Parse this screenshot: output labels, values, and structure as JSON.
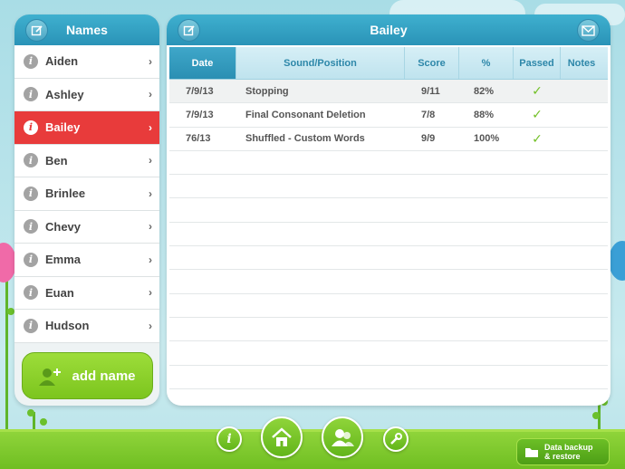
{
  "sidebar": {
    "title": "Names",
    "edit_icon": "pencil-edit-icon",
    "items": [
      {
        "label": "Aiden",
        "selected": false
      },
      {
        "label": "Ashley",
        "selected": false
      },
      {
        "label": "Bailey",
        "selected": true
      },
      {
        "label": "Ben",
        "selected": false
      },
      {
        "label": "Brinlee",
        "selected": false
      },
      {
        "label": "Chevy",
        "selected": false
      },
      {
        "label": "Emma",
        "selected": false
      },
      {
        "label": "Euan",
        "selected": false
      },
      {
        "label": "Hudson",
        "selected": false
      }
    ],
    "add_name_label": "add name"
  },
  "main": {
    "title": "Bailey",
    "table": {
      "columns": [
        "Date",
        "Sound/Position",
        "Score",
        "%",
        "Passed",
        "Notes"
      ],
      "active_column": "Date",
      "rows": [
        {
          "date": "7/9/13",
          "sound": "Stopping",
          "score": "9/11",
          "percent": "82%",
          "passed": true,
          "notes": ""
        },
        {
          "date": "7/9/13",
          "sound": "Final Consonant Deletion",
          "score": "7/8",
          "percent": "88%",
          "passed": true,
          "notes": ""
        },
        {
          "date": "76/13",
          "sound": "Shuffled - Custom Words",
          "score": "9/9",
          "percent": "100%",
          "passed": true,
          "notes": ""
        }
      ],
      "check_glyph": "✓"
    }
  },
  "bottom_nav": {
    "info_glyph": "i",
    "backup_label_line1": "Data backup",
    "backup_label_line2": "& restore"
  },
  "colors": {
    "accent_blue": "#2a93b7",
    "selected_red": "#e83b3b",
    "green": "#7cc51e",
    "check_green": "#72c026"
  }
}
